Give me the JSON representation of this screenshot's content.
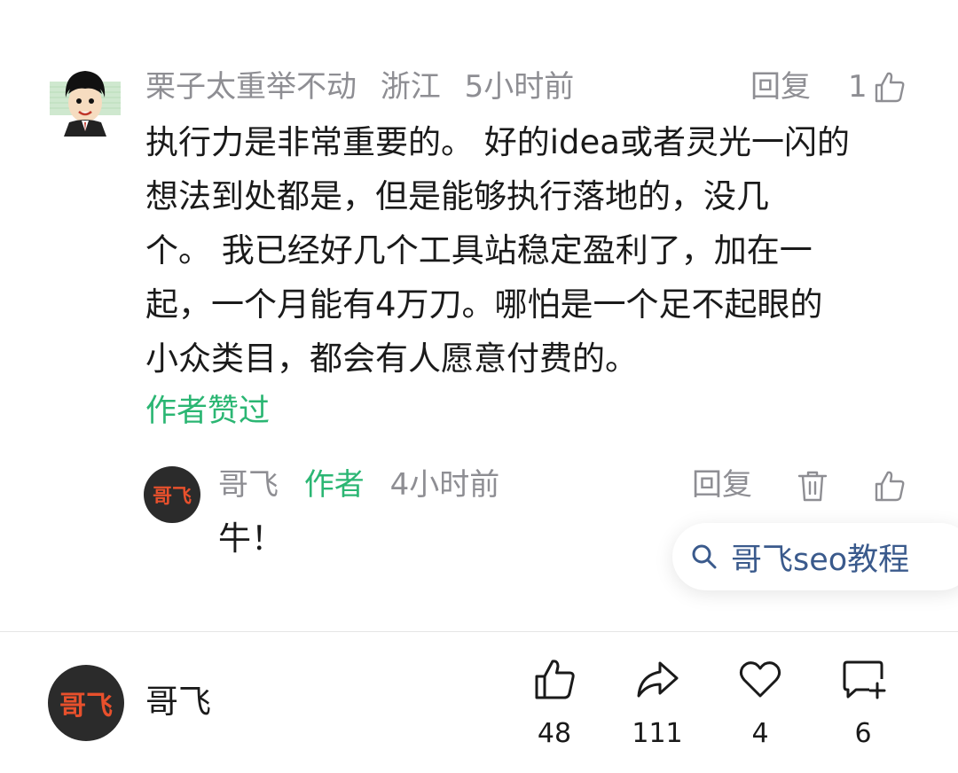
{
  "comment": {
    "username": "栗子太重举不动",
    "location": "浙江",
    "time": "5小时前",
    "reply_label": "回复",
    "like_count": "1",
    "lines": [
      "执行力是非常重要的。 好的idea或者灵光一闪的",
      "想法到处都是，但是能够执行落地的，没几",
      "个。 我已经好几个工具站稳定盈利了，加在一",
      "起，一个月能有4万刀。哪怕是一个足不起眼的",
      "小众类目，都会有人愿意付费的。"
    ],
    "author_liked": "作者赞过"
  },
  "reply": {
    "avatar_text": "哥飞",
    "username": "哥飞",
    "author_tag": "作者",
    "time": "4小时前",
    "reply_label": "回复",
    "text": "牛！"
  },
  "search": {
    "text": "哥飞seo教程"
  },
  "bottom_bar": {
    "avatar_text": "哥飞",
    "name": "哥飞",
    "like_count": "48",
    "share_count": "111",
    "favorite_count": "4",
    "comment_count": "6"
  },
  "colors": {
    "accent_green": "#2bb673",
    "meta_gray": "#8e8e93",
    "search_blue": "#3a5a8c",
    "avatar_red": "#e8502c"
  },
  "icons": [
    "thumbs-up-icon",
    "trash-icon",
    "search-icon",
    "share-icon",
    "heart-icon",
    "comment-add-icon"
  ]
}
